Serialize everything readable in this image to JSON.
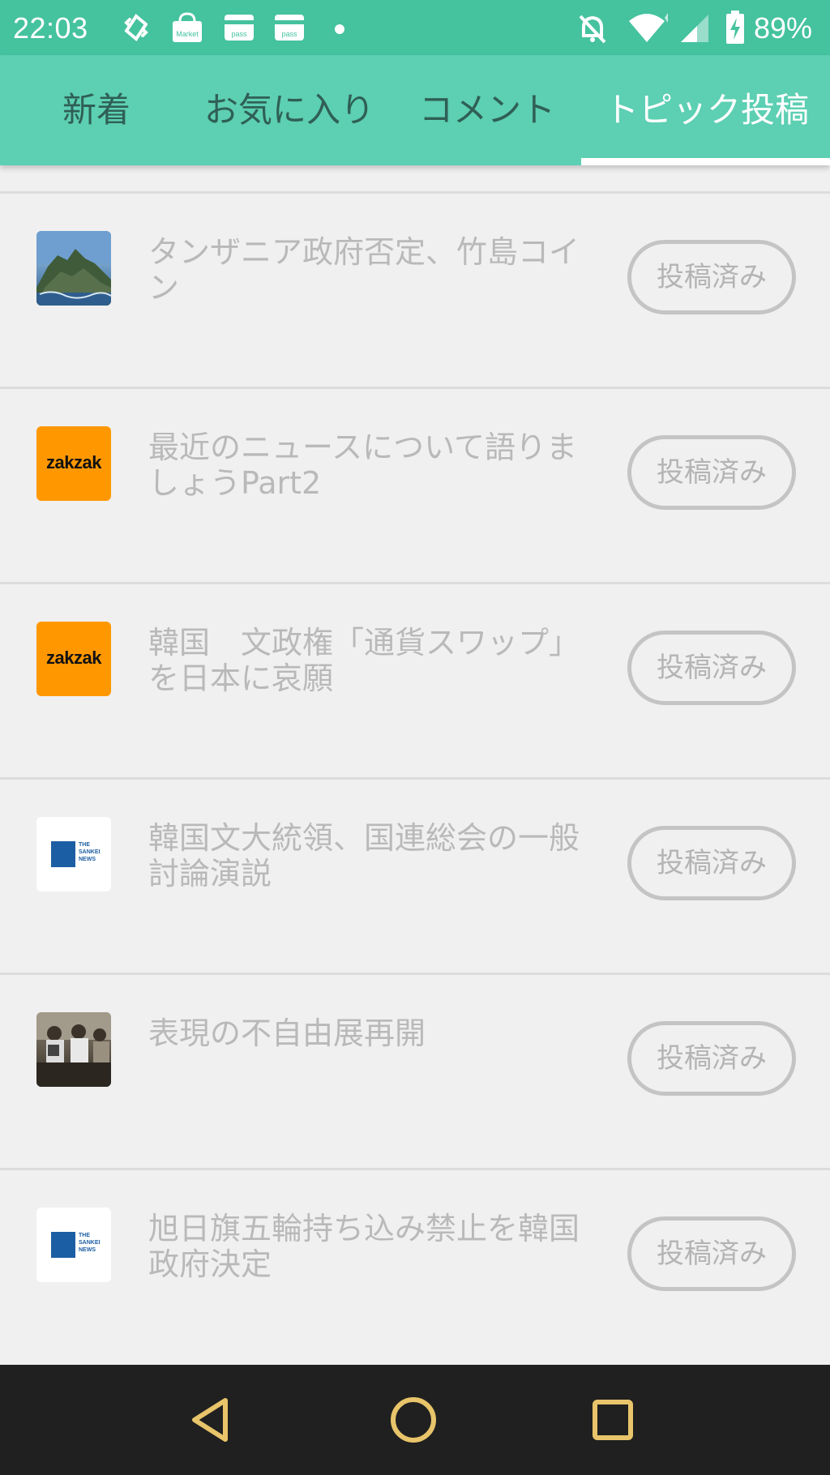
{
  "status_bar": {
    "time": "22:03",
    "battery_percent": "89%",
    "notification_icons": [
      "sync-icon",
      "market-icon",
      "pass-icon",
      "pass-icon",
      "dot-icon"
    ],
    "system_icons": [
      "bell-off-icon",
      "wifi-icon",
      "signal-icon",
      "battery-charging-icon"
    ],
    "notification_labels": {
      "market": "Market",
      "pass": "pass"
    }
  },
  "tabs": [
    {
      "label": "新着",
      "active": false
    },
    {
      "label": "お気に入り",
      "active": false
    },
    {
      "label": "コメント",
      "active": false
    },
    {
      "label": "トピック投稿",
      "active": true
    }
  ],
  "topics": [
    {
      "title": "タンザニア政府否定、竹島コイン",
      "thumbnail": "island-photo",
      "button": "投稿済み"
    },
    {
      "title": "最近のニュースについて語りましょうPart2",
      "thumbnail": "zakzak-logo",
      "button": "投稿済み"
    },
    {
      "title": "韓国　文政権「通貨スワップ」を日本に哀願",
      "thumbnail": "zakzak-logo",
      "button": "投稿済み"
    },
    {
      "title": "韓国文大統領、国連総会の一般討論演説",
      "thumbnail": "sankei-logo",
      "button": "投稿済み"
    },
    {
      "title": "表現の不自由展再開",
      "thumbnail": "exhibition-photo",
      "button": "投稿済み"
    },
    {
      "title": "旭日旗五輪持ち込み禁止を韓国政府決定",
      "thumbnail": "sankei-logo",
      "button": "投稿済み"
    }
  ],
  "logos": {
    "zakzak": "zakzak",
    "sankei": [
      "THE",
      "SANKEI",
      "NEWS"
    ]
  },
  "colors": {
    "status_bar": "#45c29e",
    "tab_bar": "#5dcfb3",
    "nav_bar": "#202020",
    "nav_icons": "#e8c46a"
  },
  "nav_bar": [
    "back-icon",
    "home-icon",
    "recents-icon"
  ]
}
